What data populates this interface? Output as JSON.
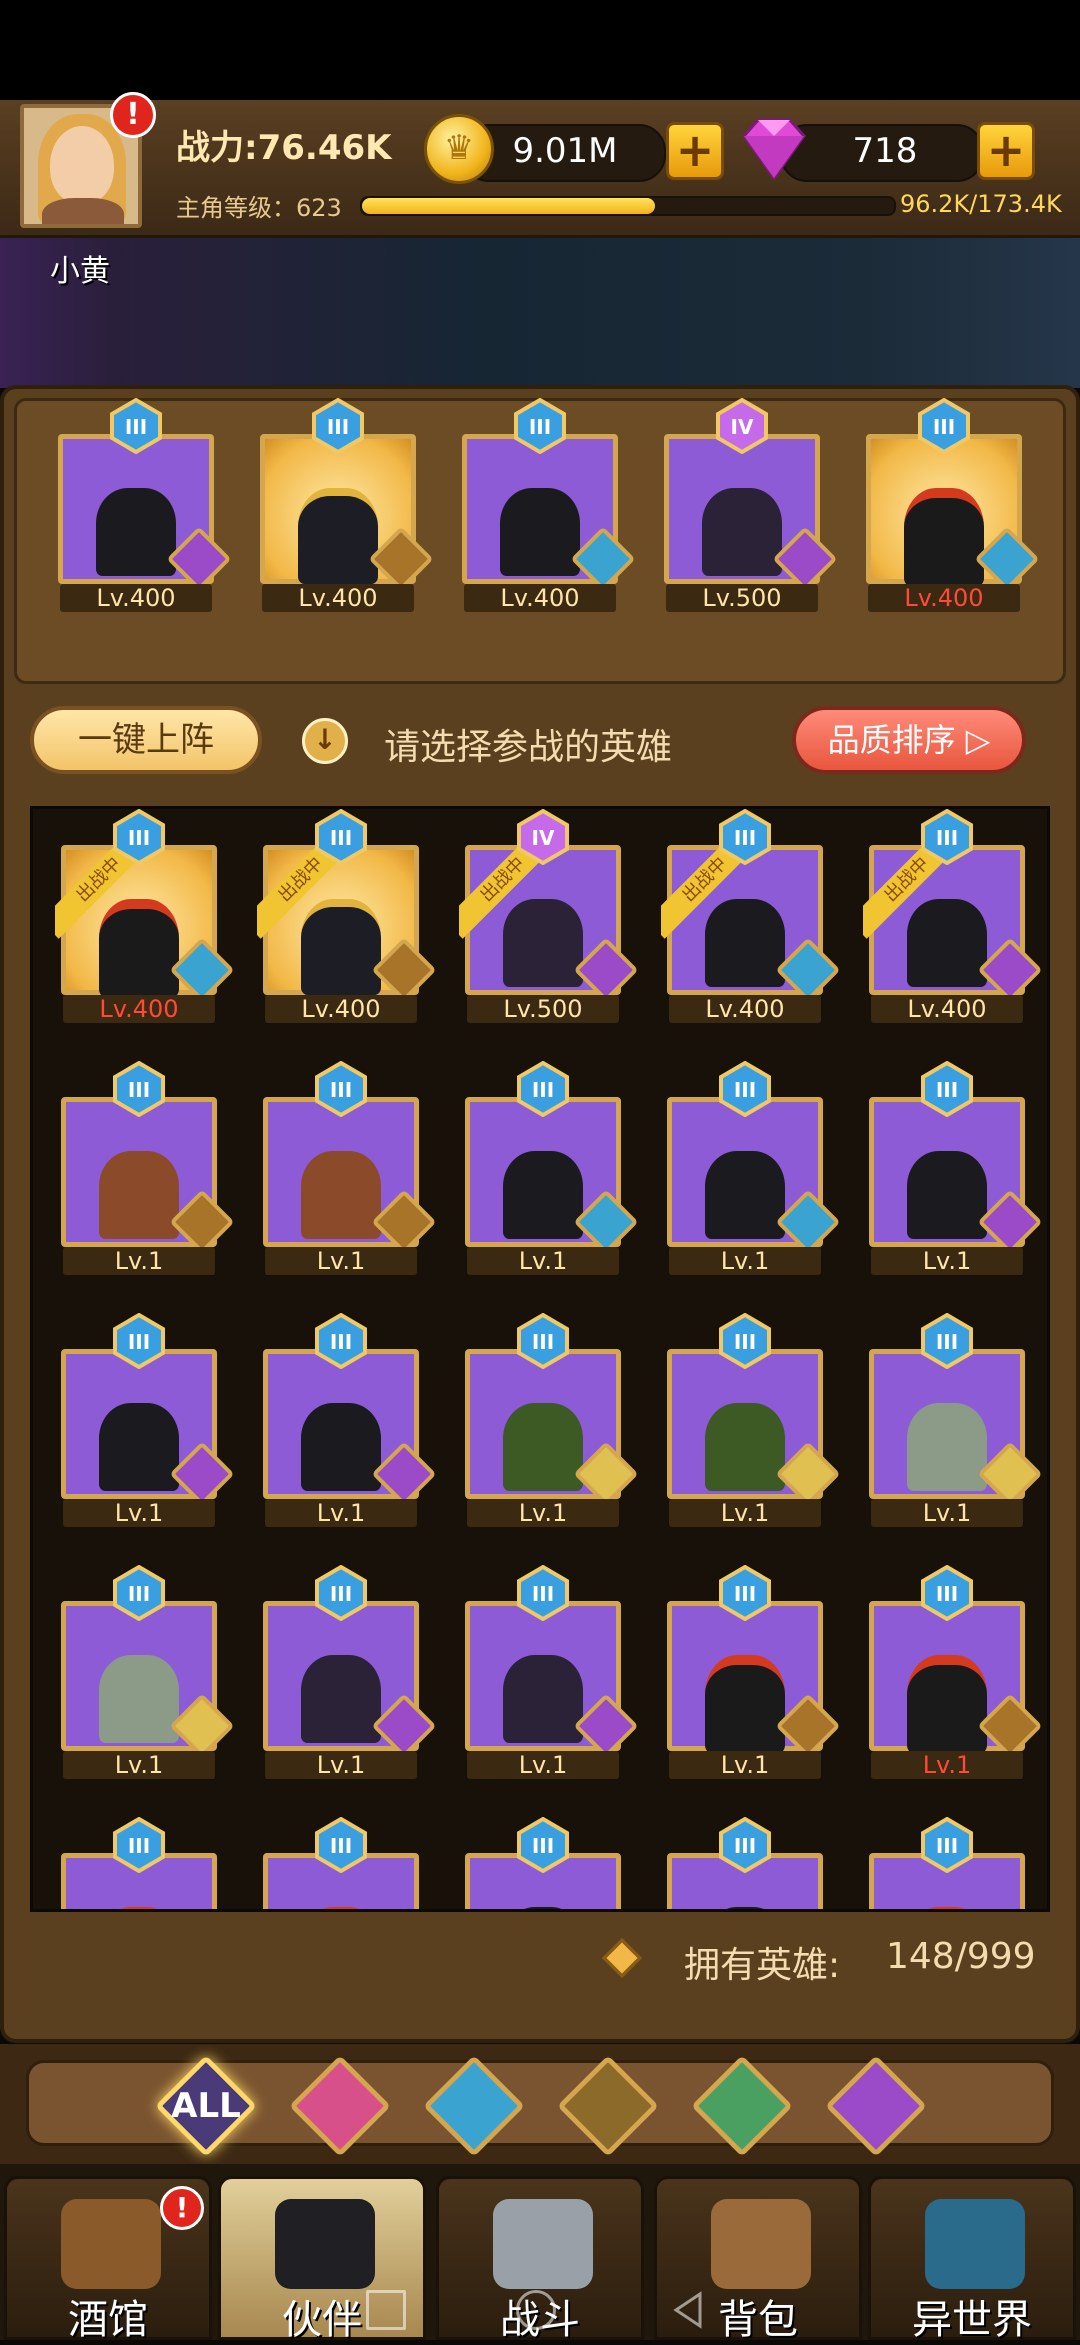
{
  "header": {
    "power": "战力:76.46K",
    "level_label": "主角等级：623",
    "xp_progress": 0.555,
    "xp_text": "96.2K/173.4K",
    "player_name": "小黄",
    "alert": "!"
  },
  "currency": {
    "gold": "9.01M",
    "gems": "718",
    "plus": "+"
  },
  "team": [
    {
      "rank": "III",
      "level": "Lv.400",
      "bg": "purple",
      "fig": "dark",
      "faction": "demon",
      "level_red": false
    },
    {
      "rank": "III",
      "level": "Lv.400",
      "bg": "gold",
      "fig": "pharaoh",
      "faction": "lion",
      "level_red": false
    },
    {
      "rank": "III",
      "level": "Lv.400",
      "bg": "purple",
      "fig": "dark",
      "faction": "fish",
      "level_red": false
    },
    {
      "rank": "IV",
      "level": "Lv.500",
      "bg": "purple",
      "fig": "horn",
      "faction": "demon",
      "level_red": false
    },
    {
      "rank": "III",
      "level": "Lv.400",
      "bg": "gold",
      "fig": "red",
      "faction": "fish",
      "level_red": true
    }
  ],
  "controls": {
    "auto_deploy": "一键上阵",
    "hint": "请选择参战的英雄",
    "sort": "品质排序",
    "deployed_tag": "出战中"
  },
  "heroes": [
    {
      "rank": "III",
      "level": "Lv.400",
      "bg": "gold",
      "fig": "red",
      "faction": "fish",
      "deployed": true,
      "level_red": true
    },
    {
      "rank": "III",
      "level": "Lv.400",
      "bg": "gold",
      "fig": "pharaoh",
      "faction": "lion",
      "deployed": true,
      "level_red": false
    },
    {
      "rank": "IV",
      "level": "Lv.500",
      "bg": "purple",
      "fig": "horn",
      "faction": "demon",
      "deployed": true,
      "level_red": false
    },
    {
      "rank": "III",
      "level": "Lv.400",
      "bg": "purple",
      "fig": "dark",
      "faction": "fish",
      "deployed": true,
      "level_red": false
    },
    {
      "rank": "III",
      "level": "Lv.400",
      "bg": "purple",
      "fig": "dark",
      "faction": "demon",
      "deployed": true,
      "level_red": false
    },
    {
      "rank": "III",
      "level": "Lv.1",
      "bg": "purple",
      "fig": "horse",
      "faction": "lion",
      "deployed": false,
      "level_red": false
    },
    {
      "rank": "III",
      "level": "Lv.1",
      "bg": "purple",
      "fig": "horse",
      "faction": "lion",
      "deployed": false,
      "level_red": false
    },
    {
      "rank": "III",
      "level": "Lv.1",
      "bg": "purple",
      "fig": "dark",
      "faction": "fish",
      "deployed": false,
      "level_red": false
    },
    {
      "rank": "III",
      "level": "Lv.1",
      "bg": "purple",
      "fig": "dark",
      "faction": "fish",
      "deployed": false,
      "level_red": false
    },
    {
      "rank": "III",
      "level": "Lv.1",
      "bg": "purple",
      "fig": "dark",
      "faction": "demon",
      "deployed": false,
      "level_red": false
    },
    {
      "rank": "III",
      "level": "Lv.1",
      "bg": "purple",
      "fig": "dark",
      "faction": "demon",
      "deployed": false,
      "level_red": false
    },
    {
      "rank": "III",
      "level": "Lv.1",
      "bg": "purple",
      "fig": "dark",
      "faction": "demon",
      "deployed": false,
      "level_red": false
    },
    {
      "rank": "III",
      "level": "Lv.1",
      "bg": "purple",
      "fig": "cloak",
      "faction": "elf",
      "deployed": false,
      "level_red": false
    },
    {
      "rank": "III",
      "level": "Lv.1",
      "bg": "purple",
      "fig": "cloak",
      "faction": "elf",
      "deployed": false,
      "level_red": false
    },
    {
      "rank": "III",
      "level": "Lv.1",
      "bg": "purple",
      "fig": "stone",
      "faction": "elf",
      "deployed": false,
      "level_red": false
    },
    {
      "rank": "III",
      "level": "Lv.1",
      "bg": "purple",
      "fig": "stone",
      "faction": "elf",
      "deployed": false,
      "level_red": false
    },
    {
      "rank": "III",
      "level": "Lv.1",
      "bg": "purple",
      "fig": "horn",
      "faction": "demon",
      "deployed": false,
      "level_red": false
    },
    {
      "rank": "III",
      "level": "Lv.1",
      "bg": "purple",
      "fig": "horn",
      "faction": "demon",
      "deployed": false,
      "level_red": false
    },
    {
      "rank": "III",
      "level": "Lv.1",
      "bg": "purple",
      "fig": "red",
      "faction": "lion",
      "deployed": false,
      "level_red": false
    },
    {
      "rank": "III",
      "level": "Lv.1",
      "bg": "purple",
      "fig": "red",
      "faction": "lion",
      "deployed": false,
      "level_red": true
    },
    {
      "rank": "III",
      "level": "",
      "bg": "purple",
      "fig": "red",
      "faction": "lion",
      "deployed": false,
      "level_red": false
    },
    {
      "rank": "III",
      "level": "",
      "bg": "purple",
      "fig": "red",
      "faction": "lion",
      "deployed": false,
      "level_red": false
    },
    {
      "rank": "III",
      "level": "",
      "bg": "purple",
      "fig": "dark",
      "faction": "demon",
      "deployed": false,
      "level_red": false
    },
    {
      "rank": "III",
      "level": "",
      "bg": "purple",
      "fig": "dark",
      "faction": "fish",
      "deployed": false,
      "level_red": false
    },
    {
      "rank": "III",
      "level": "",
      "bg": "purple",
      "fig": "red",
      "faction": "lion",
      "deployed": false,
      "level_red": false
    }
  ],
  "owned": {
    "label": "拥有英雄:",
    "count": "148/999"
  },
  "filters": [
    {
      "id": "all",
      "label": "ALL",
      "icon": "all-filter-icon"
    },
    {
      "id": "knight",
      "label": "",
      "icon": "knight-faction-icon"
    },
    {
      "id": "fish",
      "label": "",
      "icon": "fish-faction-icon"
    },
    {
      "id": "lion",
      "label": "",
      "icon": "lion-faction-icon"
    },
    {
      "id": "elf",
      "label": "",
      "icon": "elf-faction-icon"
    },
    {
      "id": "demon",
      "label": "",
      "icon": "demon-faction-icon"
    }
  ],
  "nav": {
    "tavern": "酒馆",
    "partner": "伙伴",
    "battle": "战斗",
    "bag": "背包",
    "otherworld": "异世界"
  },
  "colors": {
    "purple_card": "#8d5bd6",
    "gold_card": "#f2b847",
    "frame": "#d4a64e",
    "accent_red": "#e0251c"
  }
}
